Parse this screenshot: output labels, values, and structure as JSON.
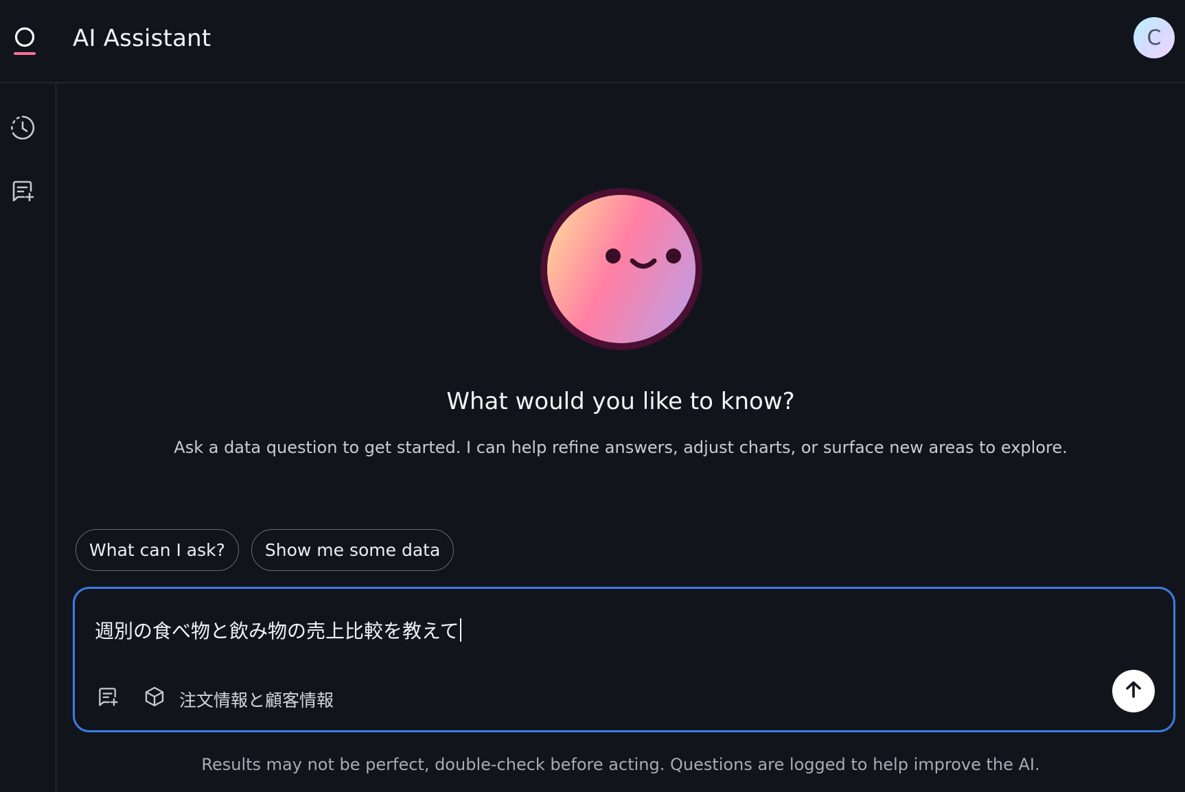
{
  "app": {
    "title": "AI Assistant",
    "logo_icon": "assistant-logo-icon",
    "avatar_initial": "C"
  },
  "rail": {
    "items": [
      {
        "icon": "history-icon"
      },
      {
        "icon": "new-chat-icon"
      }
    ]
  },
  "welcome": {
    "mascot_icon": "smiley-face-icon",
    "headline": "What would you like to know?",
    "subtitle": "Ask a data question to get started. I can help refine answers, adjust charts, or surface new areas to explore."
  },
  "suggestions": [
    {
      "label": "What can I ask?"
    },
    {
      "label": "Show me some data"
    }
  ],
  "composer": {
    "value": "週別の食べ物と飲み物の売上比較を教えて",
    "dataset_label": "注文情報と顧客情報",
    "send_icon": "arrow-up-icon",
    "accent": "#3e7be6"
  },
  "footer": {
    "disclaimer": "Results may not be perfect, double-check before acting. Questions are logged to help improve the AI."
  }
}
